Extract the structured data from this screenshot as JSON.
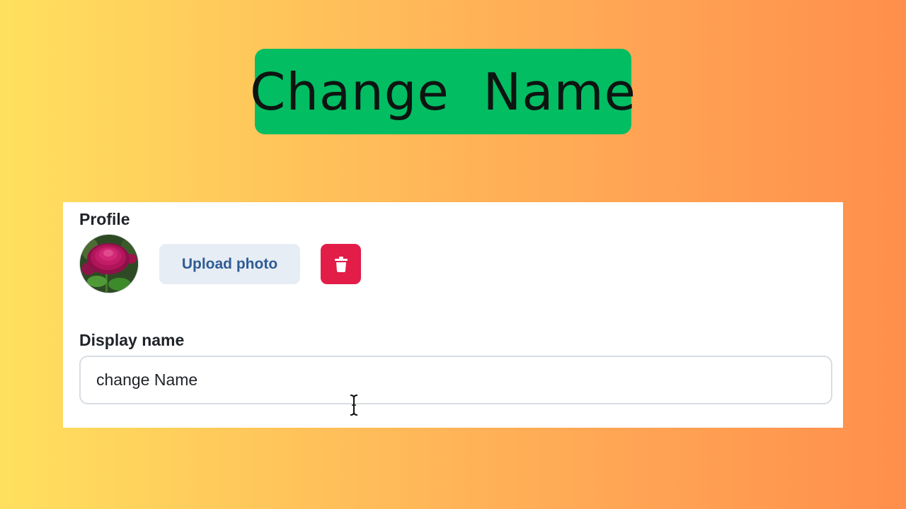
{
  "banner": {
    "title": "Change  Name"
  },
  "profile": {
    "label": "Profile",
    "upload_label": "Upload photo",
    "delete_icon": "trash-icon",
    "avatar_description_icon": "avatar-photo"
  },
  "display_name": {
    "label": "Display name",
    "value": "change Name"
  },
  "colors": {
    "banner_bg": "#02bd62",
    "upload_bg": "#e7edf5",
    "upload_text": "#2f5c94",
    "delete_bg": "#e11d48"
  }
}
